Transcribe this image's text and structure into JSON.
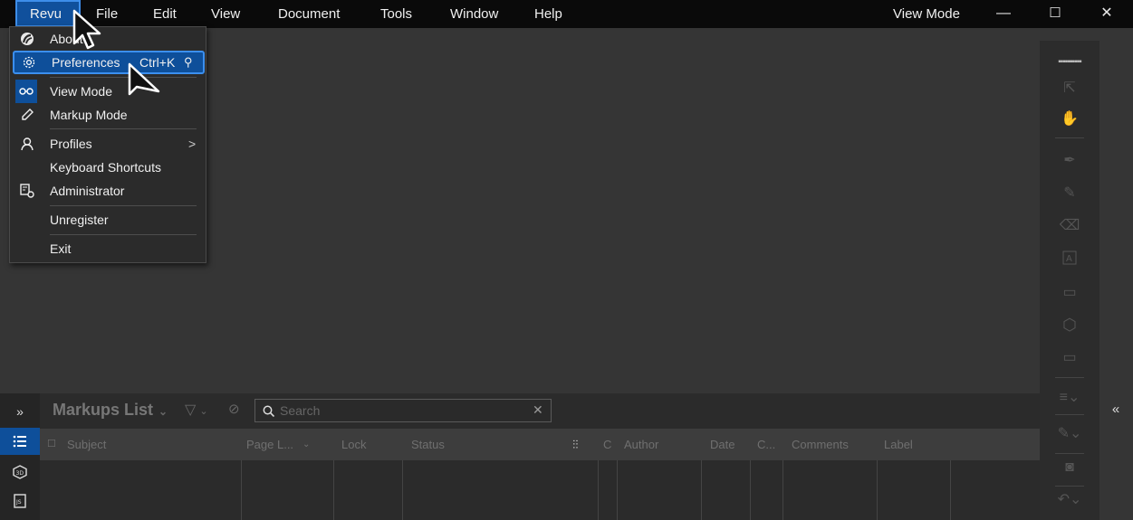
{
  "menubar": {
    "items": [
      "Revu",
      "File",
      "Edit",
      "View",
      "Document",
      "Tools",
      "Window",
      "Help"
    ],
    "mode_label": "View Mode",
    "minimize": "—",
    "maximize": "☐",
    "close": "✕"
  },
  "revu_menu": {
    "about": "About",
    "preferences": "Preferences",
    "preferences_shortcut": "Ctrl+K",
    "view_mode": "View Mode",
    "markup_mode": "Markup Mode",
    "profiles": "Profiles",
    "keyboard_shortcuts": "Keyboard Shortcuts",
    "administrator": "Administrator",
    "unregister": "Unregister",
    "exit": "Exit",
    "submenu_arrow": ">"
  },
  "markups": {
    "expand_glyph": "»",
    "title": "Markups List",
    "search_placeholder": "Search",
    "collapse_glyph": "«",
    "columns": {
      "subject": "Subject",
      "page_label": "Page L...",
      "lock": "Lock",
      "status": "Status",
      "c1": "C",
      "author": "Author",
      "date": "Date",
      "c2": "C...",
      "comments": "Comments",
      "label": "Label"
    }
  },
  "icons": {
    "revu_logo": "revu-logo-icon",
    "gear": "gear-icon",
    "glasses": "glasses-icon",
    "pencil": "pencil-icon",
    "profile": "profile-icon",
    "admin": "administrator-icon",
    "filter": "filter-icon",
    "hide": "visibility-off-icon",
    "search": "search-icon",
    "list": "list-icon",
    "3d": "3d-icon",
    "js": "js-icon"
  },
  "colors": {
    "menubar_bg": "#0a0a0a",
    "highlight": "#0e4f9a",
    "highlight_border": "#3b8fef",
    "workspace": "#353535",
    "panel": "#2b2b2b"
  }
}
